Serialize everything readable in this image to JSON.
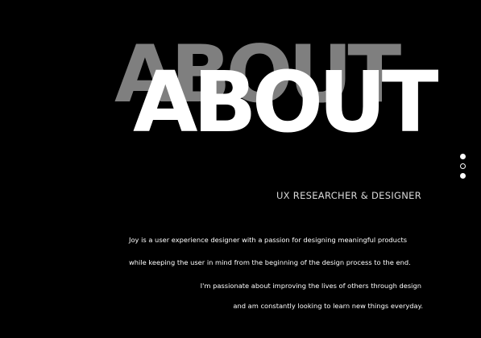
{
  "hero": {
    "title_shadow": "ABOUT",
    "title": "ABOUT"
  },
  "pager": {
    "dots": [
      {
        "state": "filled"
      },
      {
        "state": "hollow"
      },
      {
        "state": "filled"
      }
    ]
  },
  "profile": {
    "role": "UX RESEARCHER & DESIGNER",
    "bio_lines": [
      "Joy is a user experience designer with a passion for designing meaningful products",
      "while keeping the user in mind from the beginning of the design process to the end.",
      "I'm passionate about improving the lives of others through design",
      "and am constantly looking to learn new things everyday."
    ]
  },
  "colors": {
    "background": "#000000",
    "title": "#ffffff",
    "title_shadow": "#7f7f7f",
    "text": "#ffffff"
  }
}
